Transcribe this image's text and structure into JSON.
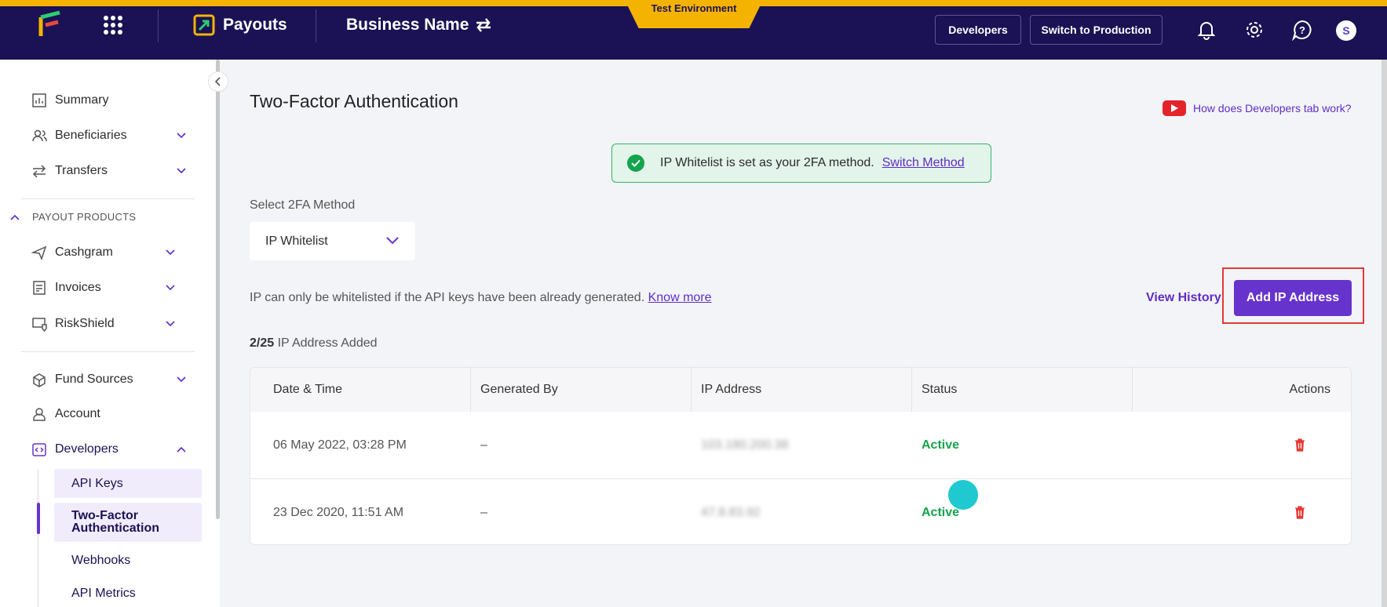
{
  "header": {
    "product": "Payouts",
    "business_name": "Business Name",
    "environment": "Test Environment",
    "developers_btn": "Developers",
    "switch_btn": "Switch to Production",
    "avatar_initial": "S"
  },
  "sidebar": {
    "items": [
      {
        "label": "Summary"
      },
      {
        "label": "Beneficiaries"
      },
      {
        "label": "Transfers"
      },
      {
        "label": "Cashgram"
      },
      {
        "label": "Invoices"
      },
      {
        "label": "RiskShield"
      },
      {
        "label": "Fund Sources"
      },
      {
        "label": "Account"
      },
      {
        "label": "Developers"
      }
    ],
    "section_label": "PAYOUT PRODUCTS",
    "sub_items": [
      {
        "label": "API Keys"
      },
      {
        "label": "Two-Factor Authentication"
      },
      {
        "label": "Webhooks"
      },
      {
        "label": "API Metrics"
      }
    ]
  },
  "main": {
    "title": "Two-Factor Authentication",
    "howto_link": "How does Developers tab work?",
    "alert_text": "IP Whitelist is set as your 2FA method.",
    "alert_link": "Switch Method",
    "select_label": "Select 2FA Method",
    "select_value": "IP Whitelist",
    "info_text": "IP can only be whitelisted if the API keys have been already generated.",
    "info_link": "Know more",
    "view_history": "View History",
    "add_button": "Add IP Address",
    "count_value": "2/25",
    "count_suffix": "IP Address Added"
  },
  "table": {
    "headers": [
      "Date & Time",
      "Generated By",
      "IP Address",
      "Status",
      "Actions"
    ],
    "rows": [
      {
        "date": "06 May 2022, 03:28 PM",
        "generated_by": "–",
        "ip": "103.180.200.38",
        "status": "Active"
      },
      {
        "date": "23 Dec 2020, 11:51 AM",
        "generated_by": "–",
        "ip": "47.8.83.92",
        "status": "Active"
      }
    ]
  },
  "colors": {
    "topbar": "#1a1254",
    "accent": "#6633cc",
    "env": "#f5b301",
    "success": "#16a34a",
    "danger": "#e53935"
  }
}
